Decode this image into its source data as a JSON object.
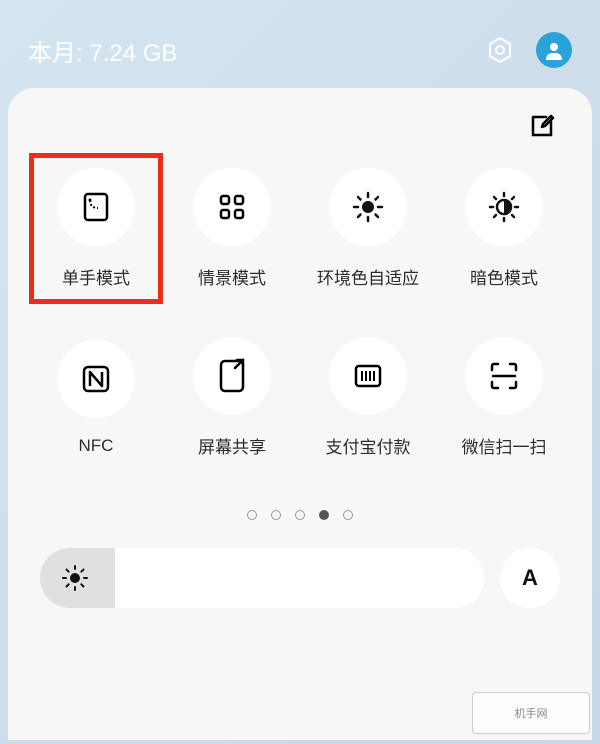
{
  "top": {
    "data_usage_label": "本月:",
    "data_usage_value": "7.24 GB"
  },
  "tiles": [
    {
      "name": "one-hand-mode",
      "label": "单手模式",
      "icon": "one-hand-icon",
      "highlighted": true
    },
    {
      "name": "scene-mode",
      "label": "情景模式",
      "icon": "grid-icon",
      "highlighted": false
    },
    {
      "name": "ambient-color",
      "label": "环境色自适应",
      "icon": "sun-half-icon",
      "highlighted": false
    },
    {
      "name": "dark-mode",
      "label": "暗色模式",
      "icon": "brightness-half-icon",
      "highlighted": false
    },
    {
      "name": "nfc",
      "label": "NFC",
      "icon": "nfc-icon",
      "highlighted": false
    },
    {
      "name": "screen-share",
      "label": "屏幕共享",
      "icon": "screen-share-icon",
      "highlighted": false
    },
    {
      "name": "alipay-pay",
      "label": "支付宝付款",
      "icon": "barcode-icon",
      "highlighted": false
    },
    {
      "name": "wechat-scan",
      "label": "微信扫一扫",
      "icon": "scan-icon",
      "highlighted": false
    }
  ],
  "pagination": {
    "total": 5,
    "active_index": 3
  },
  "brightness": {
    "auto_label": "A"
  },
  "colors": {
    "highlight": "#e83016",
    "avatar": "#2aa3d8"
  },
  "watermark": "机手网"
}
